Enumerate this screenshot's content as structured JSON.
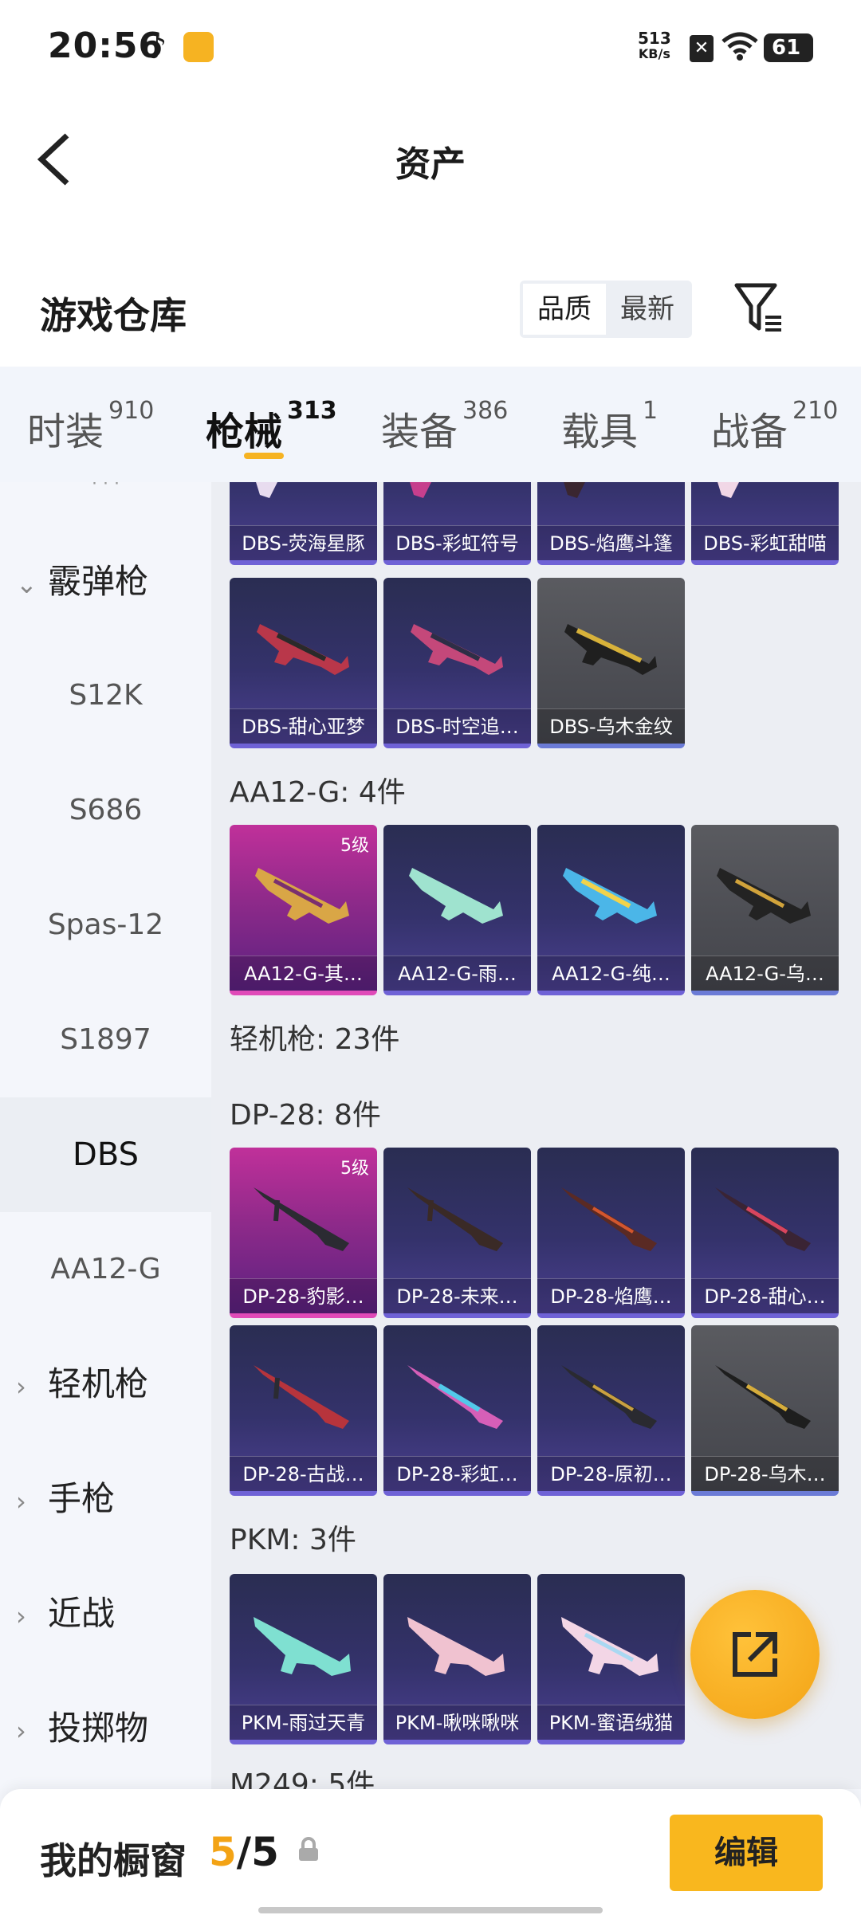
{
  "status_bar": {
    "time": "20:56",
    "net_speed": "513",
    "net_unit": "KB/s",
    "battery": "61"
  },
  "header": {
    "title": "资产"
  },
  "warehouse": {
    "title": "游戏仓库",
    "sort_options": [
      "品质",
      "最新"
    ]
  },
  "category_tabs": [
    {
      "label": "时装",
      "count": "910"
    },
    {
      "label": "枪械",
      "count": "313"
    },
    {
      "label": "装备",
      "count": "386"
    },
    {
      "label": "载具",
      "count": "1"
    },
    {
      "label": "战备",
      "count": "210"
    }
  ],
  "sidebar": {
    "group_shotgun": "霰弹枪",
    "subitems": [
      "S12K",
      "S686",
      "Spas-12",
      "S1897",
      "DBS",
      "AA12-G"
    ],
    "groups": [
      "轻机枪",
      "手枪",
      "近战",
      "投掷物"
    ]
  },
  "content": {
    "row0": [
      "DBS-荧海星豚",
      "DBS-彩虹符号",
      "DBS-焰鹰斗篷",
      "DBS-彩虹甜喵"
    ],
    "row1": [
      "DBS-甜心亚梦",
      "DBS-时空追…",
      "DBS-乌木金纹"
    ],
    "aa12_header": "AA12-G: 4件",
    "aa12": [
      "AA12-G-其…",
      "AA12-G-雨…",
      "AA12-G-纯…",
      "AA12-G-乌…"
    ],
    "lmg_header": "轻机枪: 23件",
    "dp28_header": "DP-28: 8件",
    "dp28_row1": [
      "DP-28-豹影…",
      "DP-28-未来…",
      "DP-28-焰鹰…",
      "DP-28-甜心…"
    ],
    "dp28_row2": [
      "DP-28-古战…",
      "DP-28-彩虹…",
      "DP-28-原初…",
      "DP-28-乌木…"
    ],
    "pkm_header": "PKM: 3件",
    "pkm": [
      "PKM-雨过天青",
      "PKM-啾咪啾咪",
      "PKM-蜜语绒猫"
    ],
    "m249_header": "M249: 5件",
    "level_label": "5级"
  },
  "bottom_bar": {
    "label": "我的橱窗",
    "current": "5",
    "separator": "/",
    "total": "5",
    "edit_label": "编辑"
  },
  "colors": {
    "accent": "#f9b71e",
    "card_purple": "#34326b",
    "card_gold": "#c0309a",
    "card_grey": "#4c4d53"
  }
}
